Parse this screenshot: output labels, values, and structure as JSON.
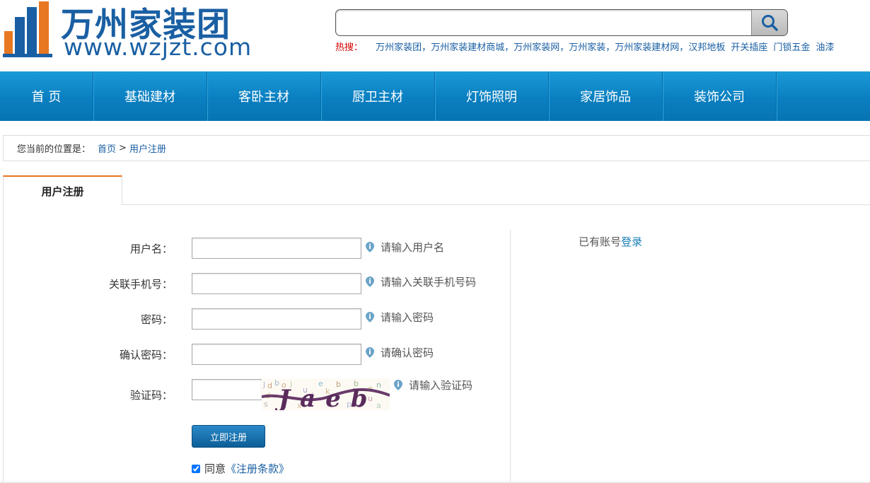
{
  "logo": {
    "cn": "万州家装团",
    "en": "www.wzjzt.com"
  },
  "search": {
    "placeholder": "",
    "button_icon": "search-icon"
  },
  "hot": {
    "label": "热搜：",
    "links": [
      "万州家装团",
      "万州家装建材商城",
      "万州家装网",
      "万州家装",
      "万州家装建材网",
      "汉邦地板",
      "开关插座",
      "门锁五金",
      "油漆"
    ]
  },
  "nav": {
    "items": [
      "首 页",
      "基础建材",
      "客卧主材",
      "厨卫主材",
      "灯饰照明",
      "家居饰品",
      "装饰公司"
    ]
  },
  "breadcrumb": {
    "prefix": "您当前的位置是：",
    "home": "首页",
    "arrow": ">",
    "current": "用户注册"
  },
  "tab": {
    "label": "用户注册"
  },
  "form": {
    "username": {
      "label": "用户名：",
      "hint": "请输入用户名",
      "value": ""
    },
    "phone": {
      "label": "关联手机号：",
      "hint": "请输入关联手机号码",
      "value": ""
    },
    "password": {
      "label": "密码：",
      "hint": "请输入密码",
      "value": ""
    },
    "confirm": {
      "label": "确认密码：",
      "hint": "请确认密码",
      "value": ""
    },
    "captcha": {
      "label": "验证码：",
      "hint": "请输入验证码",
      "value": "",
      "code": "Jaeb"
    },
    "submit_label": "立即注册",
    "agree": {
      "checked": true,
      "text": "同意",
      "terms": "《注册条款》"
    }
  },
  "login": {
    "text": "已有账号",
    "link": "登录"
  },
  "colors": {
    "nav": "#0a7fc0",
    "accent": "#e87722",
    "link": "#1a5fa3",
    "hot": "#d40000"
  }
}
